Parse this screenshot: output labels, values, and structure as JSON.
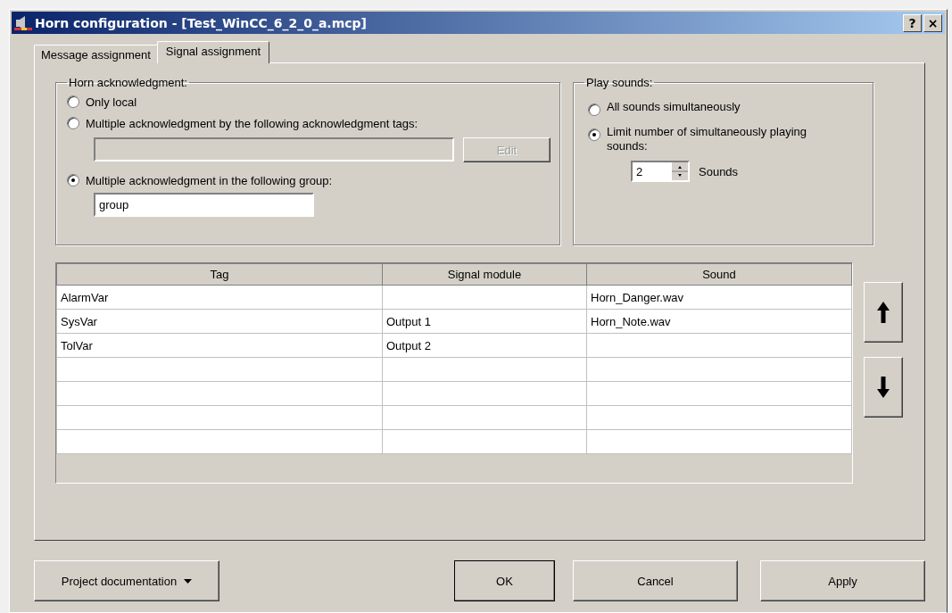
{
  "window": {
    "title": "Horn configuration - [Test_WinCC_6_2_0_a.mcp]",
    "help": "?",
    "close": "×"
  },
  "tabs": [
    {
      "label": "Message assignment",
      "selected": false
    },
    {
      "label": "Signal assignment",
      "selected": true
    }
  ],
  "horn_acknowledgment": {
    "title": "Horn acknowledgment:",
    "options": [
      {
        "label": "Only local",
        "selected": false
      },
      {
        "label": "Multiple acknowledgment by the following acknowledgment tags:",
        "selected": false
      },
      {
        "label": "Multiple acknowledgment in the following group:",
        "selected": true
      }
    ],
    "tags_field": {
      "disabled": true
    },
    "edit_button": {
      "label": "Edit",
      "disabled": true
    },
    "group_field": {
      "value": "group"
    }
  },
  "play_sounds": {
    "title": "Play sounds:",
    "options": [
      {
        "label": "All sounds simultaneously",
        "selected": false
      },
      {
        "label": "Limit number of simultaneously playing sounds:",
        "selected": true
      }
    ],
    "count": "2",
    "unit": "Sounds"
  },
  "table": {
    "columns": [
      "Tag",
      "Signal module",
      "Sound"
    ],
    "rows": [
      [
        "AlarmVar",
        "",
        "Horn_Danger.wav"
      ],
      [
        "SysVar",
        "Output 1",
        "Horn_Note.wav"
      ],
      [
        "TolVar",
        "Output 2",
        ""
      ],
      [
        "",
        "",
        ""
      ],
      [
        "",
        "",
        ""
      ],
      [
        "",
        "",
        ""
      ],
      [
        "",
        "",
        ""
      ]
    ]
  },
  "footer": {
    "documentation": "Project documentation",
    "ok": "OK",
    "cancel": "Cancel",
    "apply": "Apply"
  }
}
